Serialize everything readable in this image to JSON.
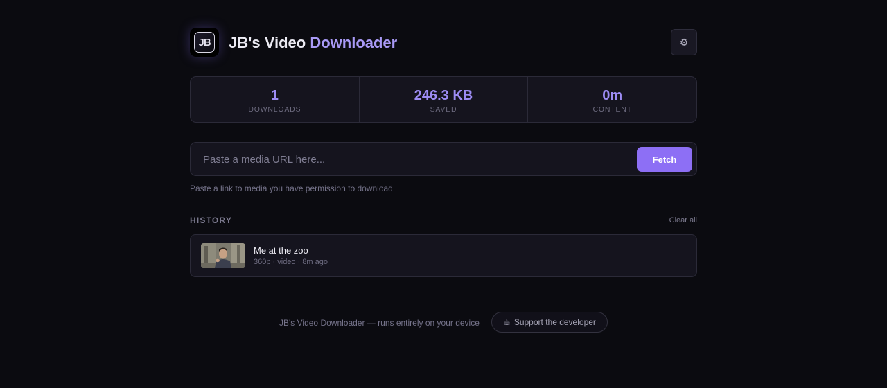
{
  "header": {
    "logo_text": "JB",
    "title_main": "JB's Video",
    "title_accent": "Downloader",
    "settings_icon": "gear-icon"
  },
  "stats": [
    {
      "value": "1",
      "label": "DOWNLOADS"
    },
    {
      "value": "246.3 KB",
      "label": "SAVED"
    },
    {
      "value": "0m",
      "label": "CONTENT"
    }
  ],
  "url_bar": {
    "value": "",
    "placeholder": "Paste a media URL here...",
    "fetch_label": "Fetch"
  },
  "hint": "Paste a link to media you have permission to download",
  "history": {
    "title": "HISTORY",
    "clear_label": "Clear all",
    "items": [
      {
        "title": "Me at the zoo",
        "meta": "360p · video · 8m ago"
      }
    ]
  },
  "footer": {
    "text": "JB's Video Downloader — runs entirely on your device",
    "support_icon": "coffee-icon",
    "support_label": "Support the developer"
  },
  "colors": {
    "background": "#0b0b10",
    "card": "#15141e",
    "accent": "#8d6ff5",
    "accent_text": "#9d8cf4"
  }
}
